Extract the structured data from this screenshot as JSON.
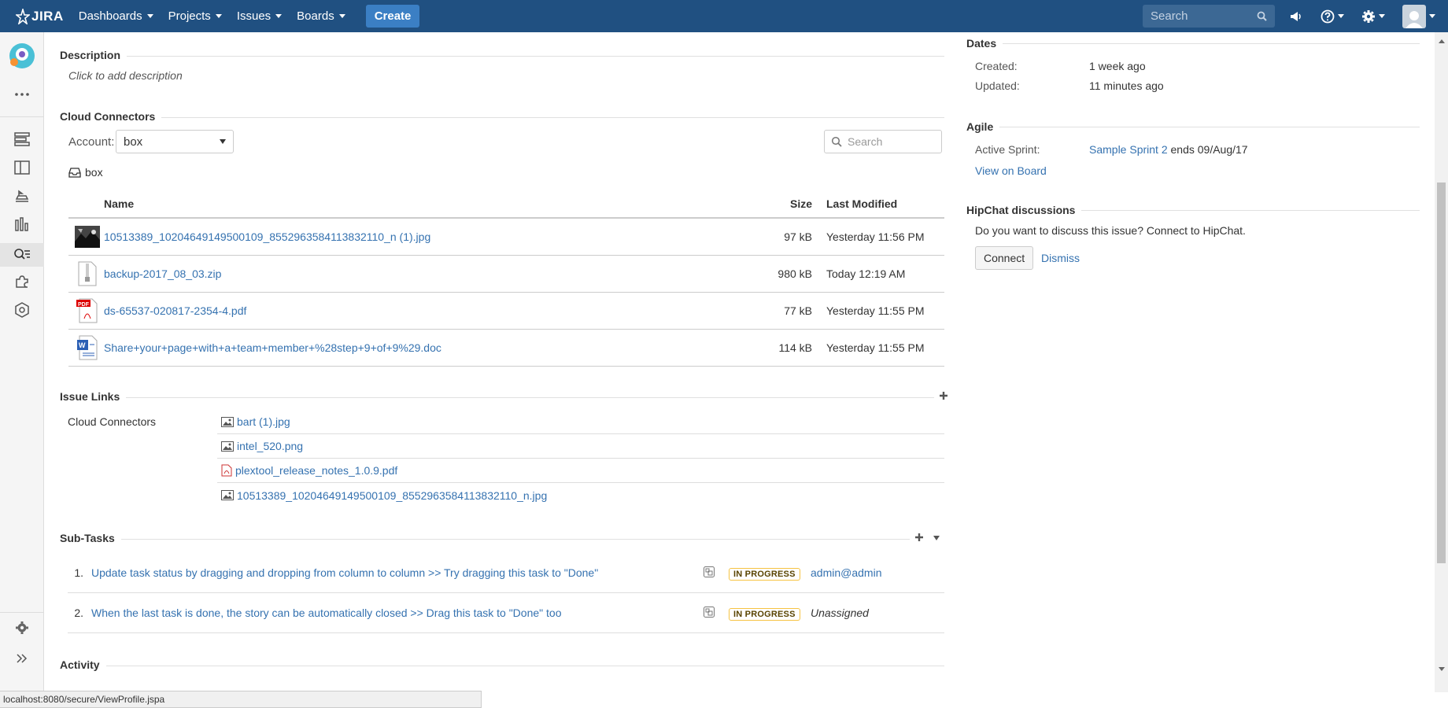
{
  "nav": {
    "logo_text": "JIRA",
    "items": [
      "Dashboards",
      "Projects",
      "Issues",
      "Boards"
    ],
    "create_label": "Create",
    "search_placeholder": "Search"
  },
  "description": {
    "heading": "Description",
    "placeholder": "Click to add description"
  },
  "cloud_connectors": {
    "heading": "Cloud Connectors",
    "account_label": "Account:",
    "account_value": "box",
    "search_placeholder": "Search",
    "folder_name": "box",
    "columns": {
      "name": "Name",
      "size": "Size",
      "modified": "Last Modified"
    },
    "files": [
      {
        "name": "10513389_10204649149500109_8552963584113832110_n (1).jpg",
        "size": "97 kB",
        "modified": "Yesterday 11:56 PM",
        "icon": "image-thumb-icon"
      },
      {
        "name": "backup-2017_08_03.zip",
        "size": "980 kB",
        "modified": "Today 12:19 AM",
        "icon": "zip-file-icon"
      },
      {
        "name": "ds-65537-020817-2354-4.pdf",
        "size": "77 kB",
        "modified": "Yesterday 11:55 PM",
        "icon": "pdf-file-icon"
      },
      {
        "name": "Share+your+page+with+a+team+member+%28step+9+of+9%29.doc",
        "size": "114 kB",
        "modified": "Yesterday 11:55 PM",
        "icon": "word-file-icon"
      }
    ]
  },
  "issue_links": {
    "heading": "Issue Links",
    "group_label": "Cloud Connectors",
    "links": [
      {
        "name": "bart (1).jpg",
        "icon": "image-icon"
      },
      {
        "name": "intel_520.png",
        "icon": "image-icon"
      },
      {
        "name": "plextool_release_notes_1.0.9.pdf",
        "icon": "pdf-icon"
      },
      {
        "name": "10513389_10204649149500109_8552963584113832110_n.jpg",
        "icon": "image-icon"
      }
    ]
  },
  "subtasks": {
    "heading": "Sub-Tasks",
    "items": [
      {
        "num": "1.",
        "summary": "Update task status by dragging and dropping from column to column >> Try dragging this task to \"Done\"",
        "status": "IN PROGRESS",
        "assignee": "admin@admin",
        "assigned": true
      },
      {
        "num": "2.",
        "summary": "When the last task is done, the story can be automatically closed >> Drag this task to \"Done\" too",
        "status": "IN PROGRESS",
        "assignee": "Unassigned",
        "assigned": false
      }
    ]
  },
  "activity": {
    "heading": "Activity"
  },
  "dates": {
    "heading": "Dates",
    "created_label": "Created:",
    "created_value": "1 week ago",
    "updated_label": "Updated:",
    "updated_value": "11 minutes ago"
  },
  "agile": {
    "heading": "Agile",
    "active_sprint_label": "Active Sprint:",
    "sprint_name": "Sample Sprint 2",
    "sprint_ends": "ends 09/Aug/17",
    "view_on_board": "View on Board"
  },
  "hipchat": {
    "heading": "HipChat discussions",
    "prompt": "Do you want to discuss this issue? Connect to HipChat.",
    "connect_label": "Connect",
    "dismiss_label": "Dismiss"
  },
  "statusbar": {
    "url": "localhost:8080/secure/ViewProfile.jspa"
  },
  "colors": {
    "nav_bg": "#205081",
    "link": "#3572b0",
    "create_btn": "#3b7fc4",
    "badge_border": "#f6c342"
  }
}
